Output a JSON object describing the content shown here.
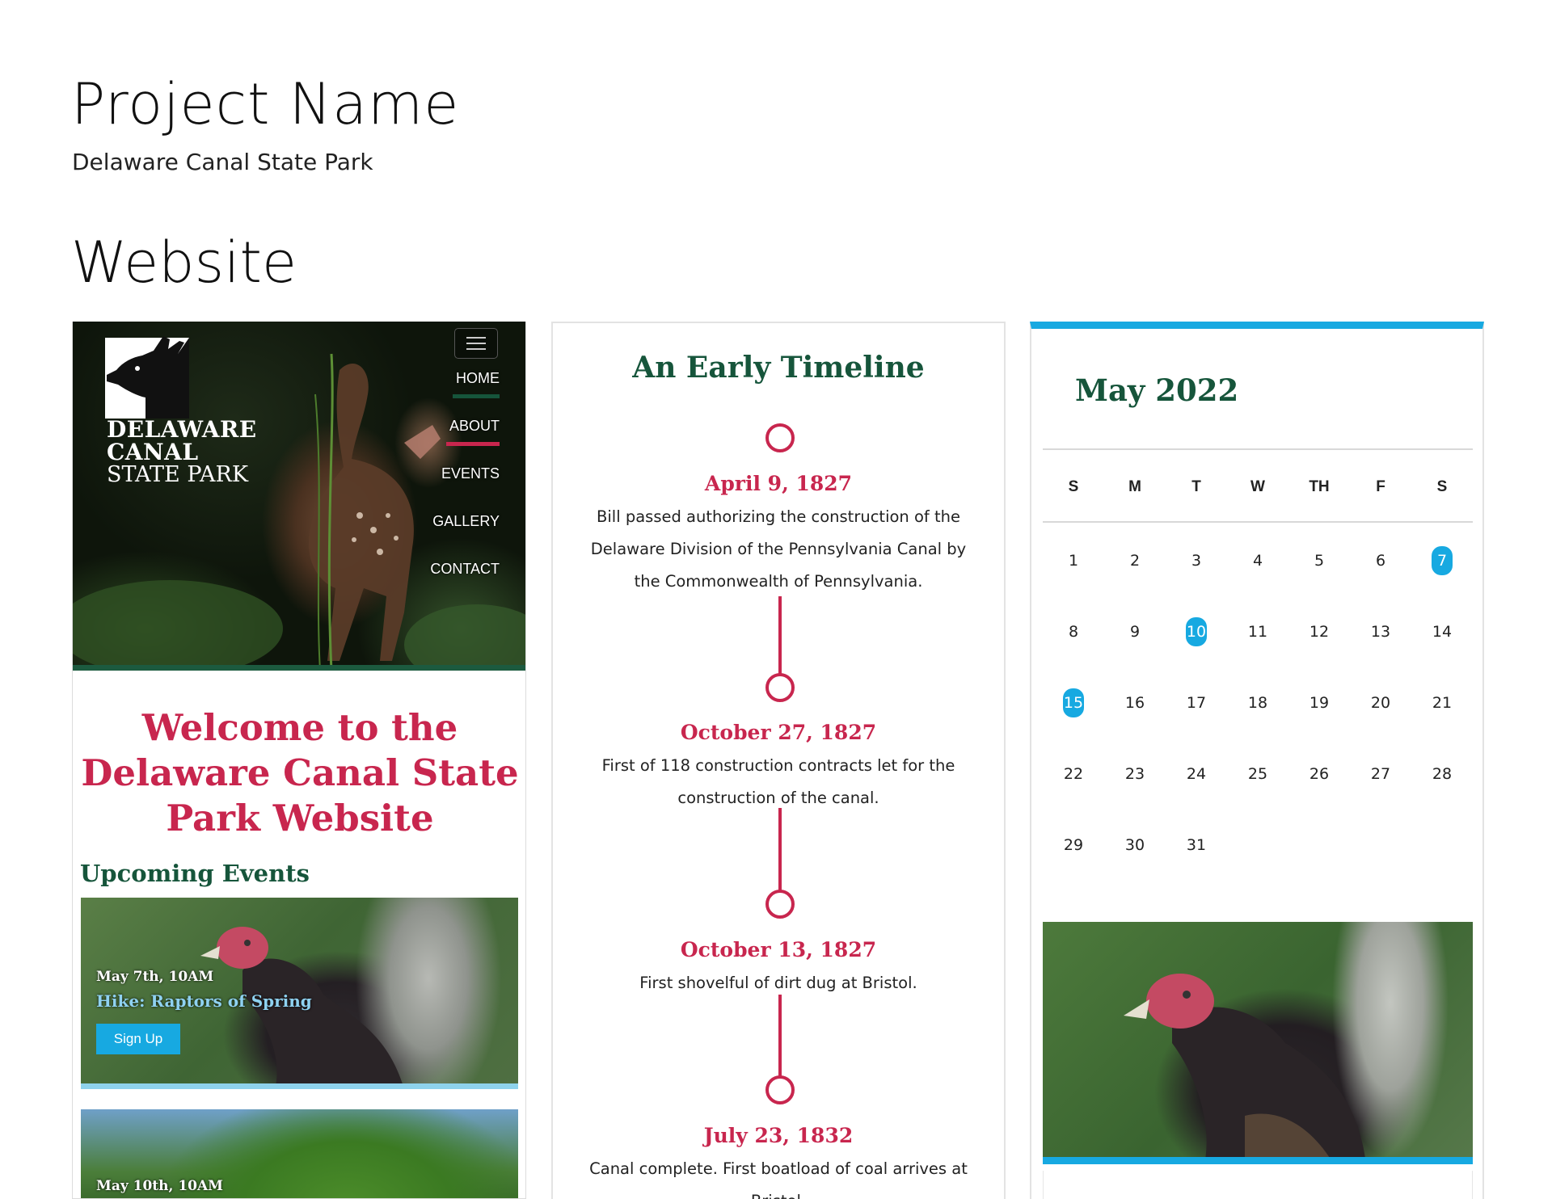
{
  "header": {
    "project_label": "Project Name",
    "project_name": "Delaware Canal State Park",
    "section": "Website"
  },
  "home": {
    "logo_line1": "DELAWARE",
    "logo_line2": "CANAL",
    "logo_line3": "STATE PARK",
    "nav": [
      "HOME",
      "ABOUT",
      "EVENTS",
      "GALLERY",
      "CONTACT"
    ],
    "welcome": "Welcome to the Delaware Canal State Park Website",
    "upcoming": "Upcoming Events",
    "events": [
      {
        "date": "May 7th, 10AM",
        "title": "Hike: Raptors of Spring",
        "button": "Sign Up"
      },
      {
        "date": "May 10th, 10AM"
      }
    ],
    "colors": {
      "accent_red": "#c8264e",
      "accent_green": "#16553b",
      "accent_blue": "#17a9e1"
    }
  },
  "timeline": {
    "title": "An Early Timeline",
    "items": [
      {
        "date": "April 9, 1827",
        "text": "Bill passed authorizing the construction of the Delaware Division of the Pennsylvania Canal by the Commonwealth of Pennsylvania."
      },
      {
        "date": "October 27, 1827",
        "text": "First of 118 construction contracts let for the construction of the canal."
      },
      {
        "date": "October 13, 1827",
        "text": "First shovelful of dirt dug at Bristol."
      },
      {
        "date": "July 23, 1832",
        "text": "Canal complete. First boatload of coal arrives at Bristol."
      }
    ]
  },
  "calendar": {
    "title": "May 2022",
    "weekdays": [
      "S",
      "M",
      "T",
      "W",
      "TH",
      "F",
      "S"
    ],
    "days": [
      "1",
      "2",
      "3",
      "4",
      "5",
      "6",
      "7",
      "8",
      "9",
      "10",
      "11",
      "12",
      "13",
      "14",
      "15",
      "16",
      "17",
      "18",
      "19",
      "20",
      "21",
      "22",
      "23",
      "24",
      "25",
      "26",
      "27",
      "28",
      "29",
      "30",
      "31"
    ],
    "highlighted": [
      "7",
      "10",
      "15"
    ]
  }
}
